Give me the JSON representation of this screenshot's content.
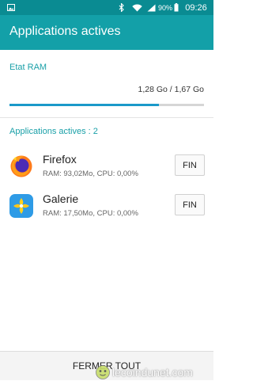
{
  "status_bar": {
    "battery_text": "90%",
    "time": "09:26",
    "icons": [
      "image-notification-icon",
      "bluetooth-icon",
      "wifi-icon",
      "signal-icon",
      "battery-icon"
    ]
  },
  "app_bar": {
    "title": "Applications actives"
  },
  "ram": {
    "label": "Etat RAM",
    "value_text": "1,28 Go / 1,67 Go",
    "used_fraction": 0.77
  },
  "apps_section": {
    "label": "Applications actives : 2"
  },
  "apps": [
    {
      "name": "Firefox",
      "stats": "RAM: 93,02Mo, CPU: 0,00%",
      "button_label": "FIN",
      "icon": "firefox-icon"
    },
    {
      "name": "Galerie",
      "stats": "RAM: 17,50Mo, CPU: 0,00%",
      "button_label": "FIN",
      "icon": "gallery-icon"
    }
  ],
  "bottom": {
    "close_all_label": "FERMER TOUT"
  },
  "watermark": {
    "text": "lecoindunet.com"
  },
  "colors": {
    "status_bar": "#0a8b92",
    "app_bar": "#13a0a8",
    "accent_text": "#1aa0a8",
    "progress_fill": "#1a99c9"
  }
}
